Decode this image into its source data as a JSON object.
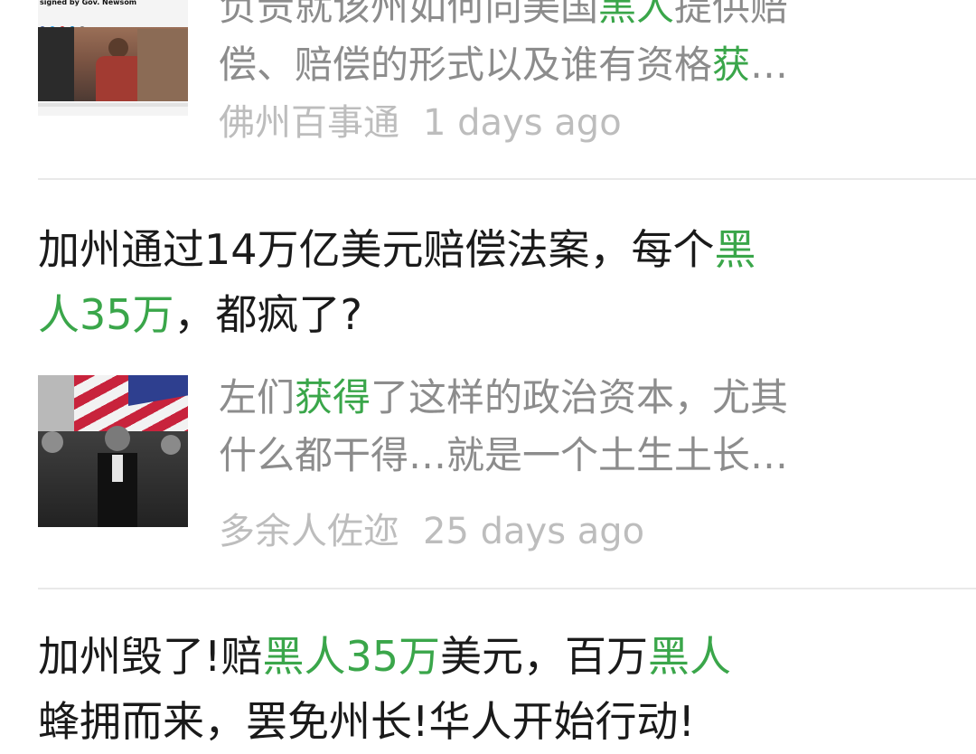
{
  "accent_color": "#3aa64a",
  "items": [
    {
      "thumbnail_caption": "reparations for slavery under bill signed by Gov. Newsom",
      "snippet": [
        [
          {
            "t": "负责就该州如何向美国",
            "h": false
          },
          {
            "t": "黑人",
            "h": true
          },
          {
            "t": "提供赔",
            "h": false
          }
        ],
        [
          {
            "t": "偿、赔偿的形式以及谁有资格",
            "h": false
          },
          {
            "t": "获",
            "h": true
          },
          {
            "t": "…",
            "h": false
          }
        ]
      ],
      "source": "佛州百事通",
      "time": "1 days ago"
    },
    {
      "title": [
        [
          {
            "t": "加州通过14万亿美元赔偿法案，每个",
            "h": false
          },
          {
            "t": "黑",
            "h": true
          }
        ],
        [
          {
            "t": "人35万",
            "h": true
          },
          {
            "t": "，都疯了?",
            "h": false
          }
        ]
      ],
      "snippet": [
        [
          {
            "t": "左们",
            "h": false
          },
          {
            "t": "获得",
            "h": true
          },
          {
            "t": "了这样的政治资本，尤其",
            "h": false
          }
        ],
        [
          {
            "t": "什么都干得…就是一个土生土长…",
            "h": false
          }
        ]
      ],
      "source": "多余人佐迩",
      "time": "25 days ago"
    },
    {
      "title": [
        [
          {
            "t": "加州毁了!赔",
            "h": false
          },
          {
            "t": "黑人35万",
            "h": true
          },
          {
            "t": "美元，百万",
            "h": false
          },
          {
            "t": "黑人",
            "h": true
          }
        ],
        [
          {
            "t": "蜂拥而来，罢免州长!华人开始行动!",
            "h": false
          }
        ]
      ]
    }
  ]
}
